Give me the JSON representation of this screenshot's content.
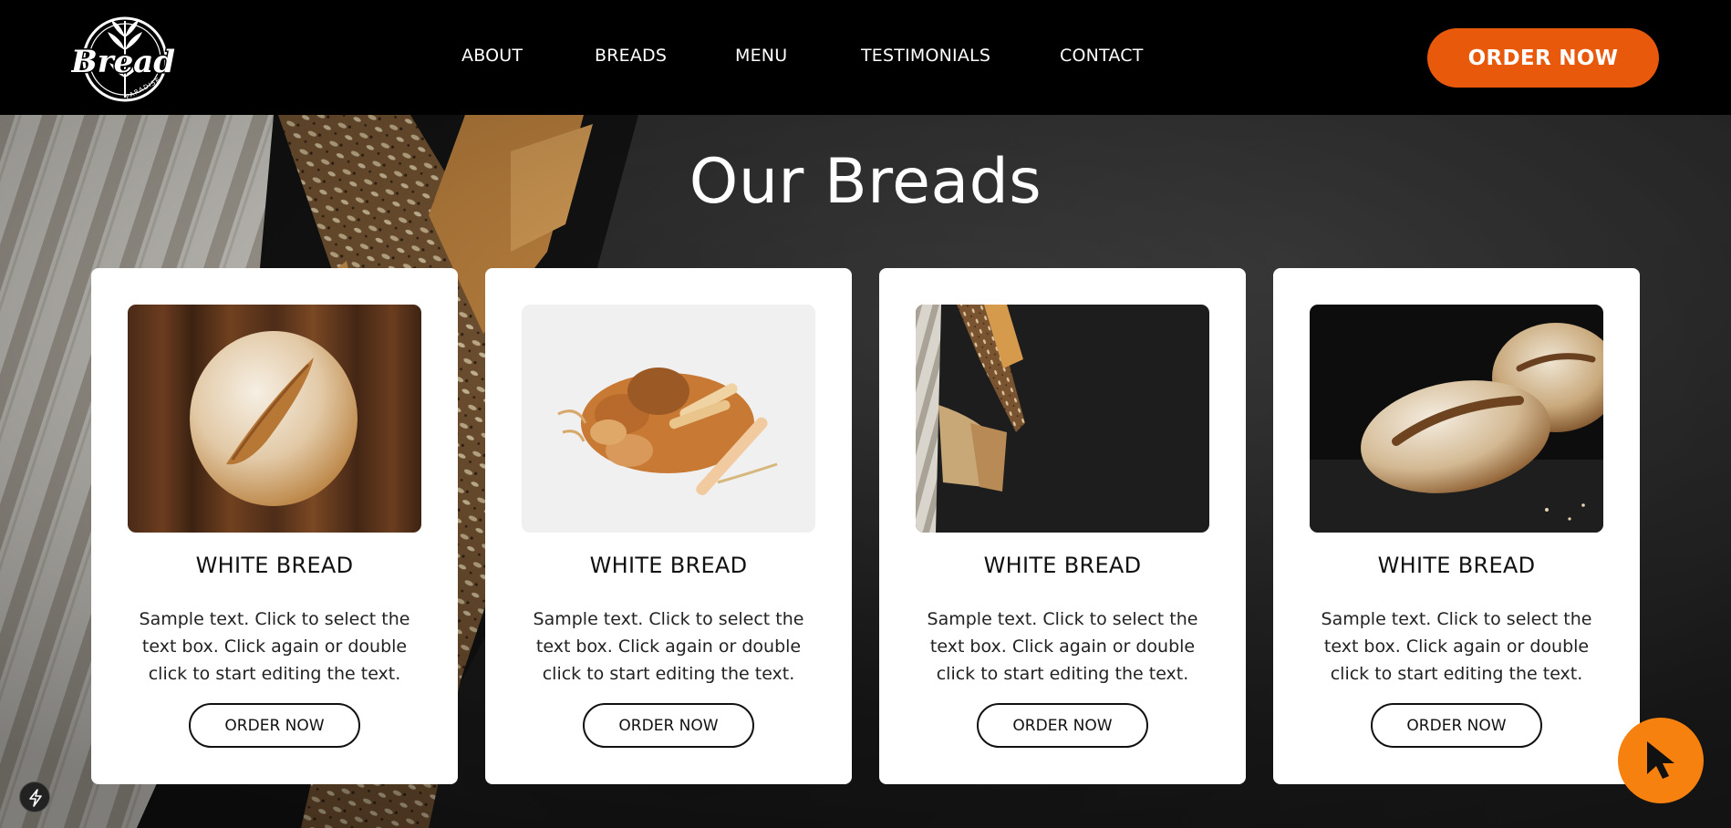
{
  "brand": {
    "logo_word": "Bread",
    "logo_sub": "PARADISE"
  },
  "nav": {
    "items": [
      {
        "label": "ABOUT"
      },
      {
        "label": "BREADS"
      },
      {
        "label": "MENU"
      },
      {
        "label": "TESTIMONIALS"
      },
      {
        "label": "CONTACT"
      }
    ],
    "cta_label": "ORDER NOW"
  },
  "section": {
    "title": "Our Breads"
  },
  "cards": [
    {
      "title": "WHITE BREAD",
      "description": "Sample text. Click to select the text box. Click again or double click to start editing the text.",
      "button_label": "ORDER NOW",
      "image": "round-loaf-on-wood"
    },
    {
      "title": "WHITE BREAD",
      "description": "Sample text. Click to select the text box. Click again or double click to start editing the text.",
      "button_label": "ORDER NOW",
      "image": "bread-basket-with-rolling-pin"
    },
    {
      "title": "WHITE BREAD",
      "description": "Sample text. Click to select the text box. Click again or double click to start editing the text.",
      "button_label": "ORDER NOW",
      "image": "baguettes-on-dark-board"
    },
    {
      "title": "WHITE BREAD",
      "description": "Sample text. Click to select the text box. Click again or double click to start editing the text.",
      "button_label": "ORDER NOW",
      "image": "sourdough-loaves-on-black"
    }
  ],
  "floating": {
    "action_icon": "cursor-icon",
    "badge_icon": "lightning-icon"
  },
  "colors": {
    "accent": "#e8590c",
    "fab": "#f7810e",
    "header_bg": "#000000"
  }
}
